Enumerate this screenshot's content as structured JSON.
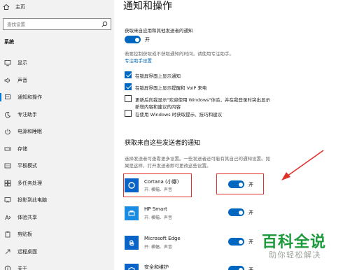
{
  "sidebar": {
    "home_label": "主页",
    "search_placeholder": "查找设置",
    "section_title": "系统",
    "items": [
      {
        "label": "显示",
        "icon": "monitor-icon"
      },
      {
        "label": "声音",
        "icon": "speaker-icon"
      },
      {
        "label": "通知和操作",
        "icon": "notification-icon",
        "active": true
      },
      {
        "label": "专注助手",
        "icon": "moon-icon"
      },
      {
        "label": "电源和睡眠",
        "icon": "power-icon"
      },
      {
        "label": "存储",
        "icon": "storage-icon"
      },
      {
        "label": "平板模式",
        "icon": "tablet-icon"
      },
      {
        "label": "多任务处理",
        "icon": "multitask-icon"
      },
      {
        "label": "投影到此电脑",
        "icon": "project-icon"
      },
      {
        "label": "体验共享",
        "icon": "share-icon"
      },
      {
        "label": "剪贴板",
        "icon": "clipboard-icon"
      },
      {
        "label": "远程桌面",
        "icon": "remote-icon"
      },
      {
        "label": "关于",
        "icon": "info-icon"
      }
    ]
  },
  "main": {
    "title": "通知和操作",
    "notif_label": "获取来自应用和其他发送者的通知",
    "notif_state": "开",
    "focus_hint": "若要控制获取或不获取通知的时间，请使用专注助手。",
    "focus_link": "专注助手设置",
    "checkboxes": [
      {
        "label": "在锁屏界面上显示通知",
        "checked": true
      },
      {
        "label": "在锁屏界面上显示提醒和 VoIP 来电",
        "checked": true
      },
      {
        "label": "更新后向我显示\"欢迎使用 Windows\"体验，并在我登录时突出显示",
        "label2": "新增内容和建议的内容",
        "checked": false
      },
      {
        "label": "在使用 Windows 时获取提示、技巧和建议",
        "checked": false
      }
    ],
    "senders_title": "获取来自这些发送者的通知",
    "senders_desc1": "选择发送者可查看更多设置。一些发送者还可能有其自己的通知设置。如",
    "senders_desc2": "果是这样，打开发送者即可更改这些设置。",
    "apps": [
      {
        "name": "Cortana (小娜)",
        "sub": "开: 横幅、声音",
        "state": "开",
        "icon": "cortana-icon"
      },
      {
        "name": "HP Smart",
        "sub": "开: 横幅、声音",
        "state": "开",
        "icon": "hp-smart-icon"
      },
      {
        "name": "Microsoft Edge",
        "sub": "开: 横幅、声音",
        "state": "开",
        "icon": "edge-icon"
      },
      {
        "name": "安全和维护",
        "sub": "",
        "state": "开",
        "icon": "security-icon"
      }
    ]
  },
  "watermark": {
    "line1": "百科全说",
    "line2": "助你轻松解决"
  },
  "colors": {
    "accent": "#0067c0",
    "annotation": "#e0312c",
    "watermark": "#1c9a3c"
  }
}
